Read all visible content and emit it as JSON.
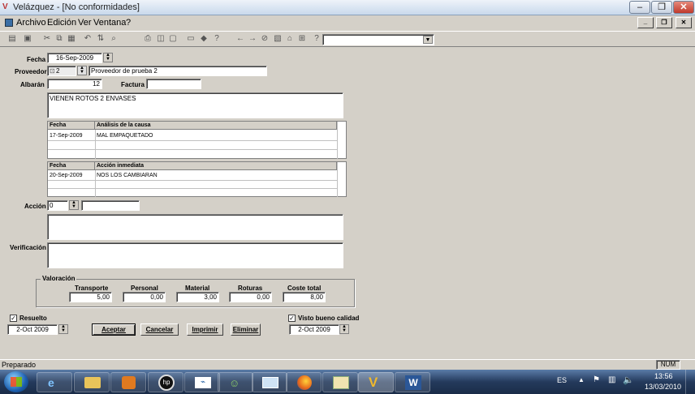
{
  "window": {
    "title": "Velázquez - [No conformidades]"
  },
  "menu": {
    "archivo": "Archivo",
    "edicion": "Edición",
    "ver": "Ver",
    "ventana": "Ventana",
    "ayuda": "?"
  },
  "form": {
    "fecha_label": "Fecha",
    "fecha": "16-Sep-2009",
    "proveedor_label": "Proveedor",
    "proveedor_code": "2",
    "proveedor_name": "Proveedor de prueba 2",
    "albaran_label": "Albarán",
    "albaran": "12",
    "factura_label": "Factura",
    "factura": "",
    "description": "VIENEN ROTOS 2 ENVASES",
    "causa": {
      "headers": [
        "Fecha",
        "Análisis de la causa"
      ],
      "rows": [
        [
          "17-Sep-2009",
          "MAL EMPAQUETADO"
        ]
      ]
    },
    "accion_inm": {
      "headers": [
        "Fecha",
        "Acción inmediata"
      ],
      "rows": [
        [
          "20-Sep-2009",
          "NOS LOS CAMBIARAN"
        ]
      ]
    },
    "accion_label": "Acción",
    "accion_code": "0",
    "accion_name": "",
    "verificacion_label": "Verificación",
    "valoracion": {
      "title": "Valoración",
      "transporte_label": "Transporte",
      "transporte": "5,00",
      "personal_label": "Personal",
      "personal": "0,00",
      "material_label": "Material",
      "material": "3,00",
      "roturas_label": "Roturas",
      "roturas": "0,00",
      "coste_label": "Coste total",
      "coste": "8,00"
    },
    "resuelto_label": "Resuelto",
    "resuelto_date": "2-Oct 2009",
    "visto_label": "Visto bueno calidad",
    "visto_date": "2-Oct 2009",
    "aceptar": "Aceptar",
    "cancelar": "Cancelar",
    "imprimir": "Imprimir",
    "eliminar": "Eliminar"
  },
  "status": {
    "text": "Preparado",
    "num": "NUM"
  },
  "taskbar": {
    "lang": "ES",
    "time": "13:56",
    "date": "13/03/2010"
  }
}
